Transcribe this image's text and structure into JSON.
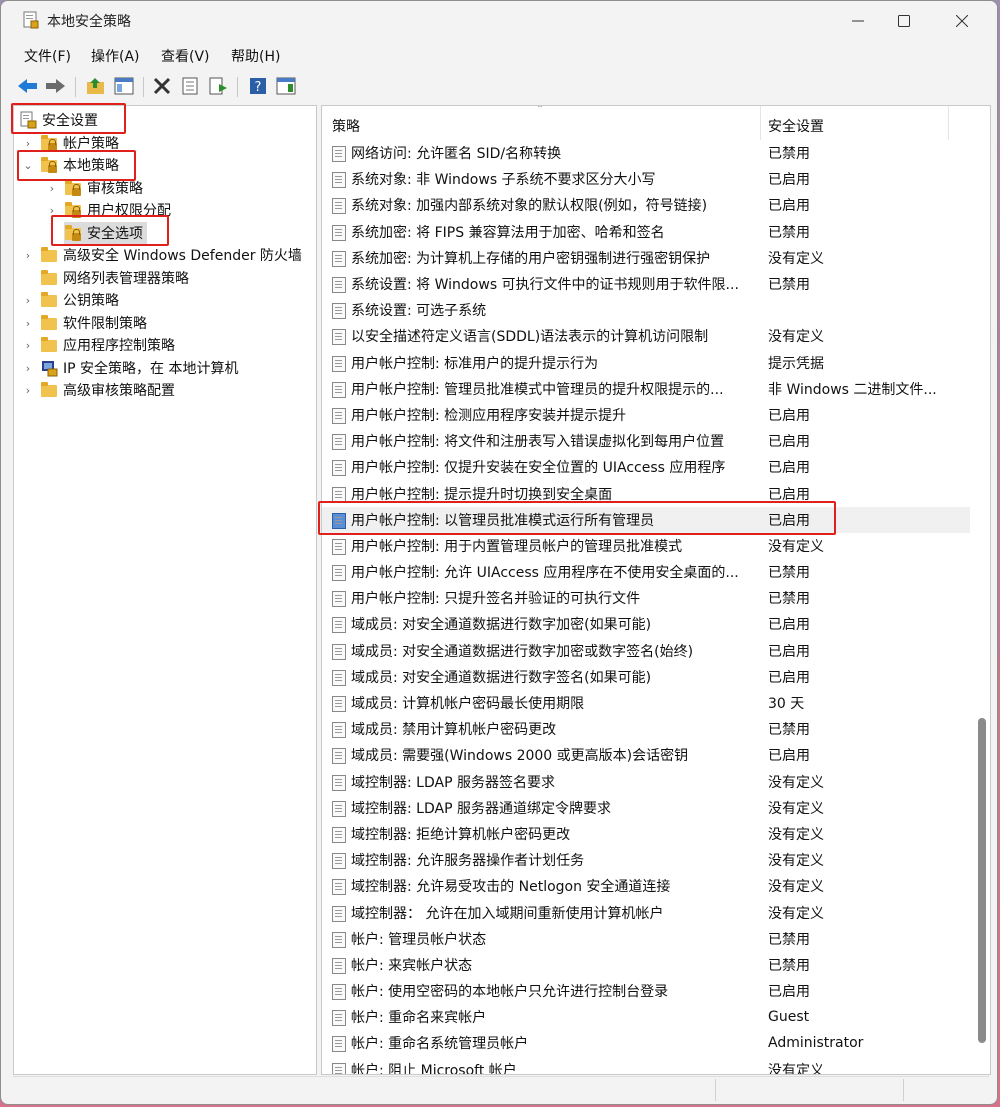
{
  "window": {
    "title": "本地安全策略"
  },
  "menu": [
    "文件(F)",
    "操作(A)",
    "查看(V)",
    "帮助(H)"
  ],
  "tree": [
    {
      "label": "安全设置"
    },
    {
      "label": "帐户策略"
    },
    {
      "label": "本地策略"
    },
    {
      "label": "审核策略"
    },
    {
      "label": "用户权限分配"
    },
    {
      "label": "安全选项"
    },
    {
      "label": "高级安全 Windows Defender 防火墙"
    },
    {
      "label": "网络列表管理器策略"
    },
    {
      "label": "公钥策略"
    },
    {
      "label": "软件限制策略"
    },
    {
      "label": "应用程序控制策略"
    },
    {
      "label": "IP 安全策略，在 本地计算机"
    },
    {
      "label": "高级审核策略配置"
    }
  ],
  "table": {
    "headers": [
      "策略",
      "安全设置"
    ],
    "rows": [
      {
        "name": "网络访问: 允许匿名 SID/名称转换",
        "value": "已禁用"
      },
      {
        "name": "系统对象: 非 Windows 子系统不要求区分大小写",
        "value": "已启用"
      },
      {
        "name": "系统对象: 加强内部系统对象的默认权限(例如，符号链接)",
        "value": "已启用"
      },
      {
        "name": "系统加密: 将 FIPS 兼容算法用于加密、哈希和签名",
        "value": "已禁用"
      },
      {
        "name": "系统加密: 为计算机上存储的用户密钥强制进行强密钥保护",
        "value": "没有定义"
      },
      {
        "name": "系统设置: 将 Windows 可执行文件中的证书规则用于软件限...",
        "value": "已禁用"
      },
      {
        "name": "系统设置: 可选子系统",
        "value": ""
      },
      {
        "name": "以安全描述符定义语言(SDDL)语法表示的计算机访问限制",
        "value": "没有定义"
      },
      {
        "name": "用户帐户控制: 标准用户的提升提示行为",
        "value": "提示凭据"
      },
      {
        "name": "用户帐户控制: 管理员批准模式中管理员的提升权限提示的...",
        "value": "非 Windows 二进制文件..."
      },
      {
        "name": "用户帐户控制: 检测应用程序安装并提示提升",
        "value": "已启用"
      },
      {
        "name": "用户帐户控制: 将文件和注册表写入错误虚拟化到每用户位置",
        "value": "已启用"
      },
      {
        "name": "用户帐户控制: 仅提升安装在安全位置的 UIAccess 应用程序",
        "value": "已启用"
      },
      {
        "name": "用户帐户控制: 提示提升时切换到安全桌面",
        "value": "已启用"
      },
      {
        "name": "用户帐户控制: 以管理员批准模式运行所有管理员",
        "value": "已启用"
      },
      {
        "name": "用户帐户控制: 用于内置管理员帐户的管理员批准模式",
        "value": "没有定义"
      },
      {
        "name": "用户帐户控制: 允许 UIAccess 应用程序在不使用安全桌面的...",
        "value": "已禁用"
      },
      {
        "name": "用户帐户控制: 只提升签名并验证的可执行文件",
        "value": "已禁用"
      },
      {
        "name": "域成员: 对安全通道数据进行数字加密(如果可能)",
        "value": "已启用"
      },
      {
        "name": "域成员: 对安全通道数据进行数字加密或数字签名(始终)",
        "value": "已启用"
      },
      {
        "name": "域成员: 对安全通道数据进行数字签名(如果可能)",
        "value": "已启用"
      },
      {
        "name": "域成员: 计算机帐户密码最长使用期限",
        "value": "30 天"
      },
      {
        "name": "域成员: 禁用计算机帐户密码更改",
        "value": "已禁用"
      },
      {
        "name": "域成员: 需要强(Windows 2000 或更高版本)会话密钥",
        "value": "已启用"
      },
      {
        "name": "域控制器: LDAP 服务器签名要求",
        "value": "没有定义"
      },
      {
        "name": "域控制器: LDAP 服务器通道绑定令牌要求",
        "value": "没有定义"
      },
      {
        "name": "域控制器: 拒绝计算机帐户密码更改",
        "value": "没有定义"
      },
      {
        "name": "域控制器: 允许服务器操作者计划任务",
        "value": "没有定义"
      },
      {
        "name": "域控制器: 允许易受攻击的 Netlogon 安全通道连接",
        "value": "没有定义"
      },
      {
        "name": "域控制器：  允许在加入域期间重新使用计算机帐户",
        "value": "没有定义"
      },
      {
        "name": "帐户: 管理员帐户状态",
        "value": "已禁用"
      },
      {
        "name": "帐户: 来宾帐户状态",
        "value": "已禁用"
      },
      {
        "name": "帐户: 使用空密码的本地帐户只允许进行控制台登录",
        "value": "已启用"
      },
      {
        "name": "帐户: 重命名来宾帐户",
        "value": "Guest"
      },
      {
        "name": "帐户: 重命名系统管理员帐户",
        "value": "Administrator"
      },
      {
        "name": "帐户: 阻止 Microsoft 帐户",
        "value": "没有定义"
      }
    ]
  }
}
